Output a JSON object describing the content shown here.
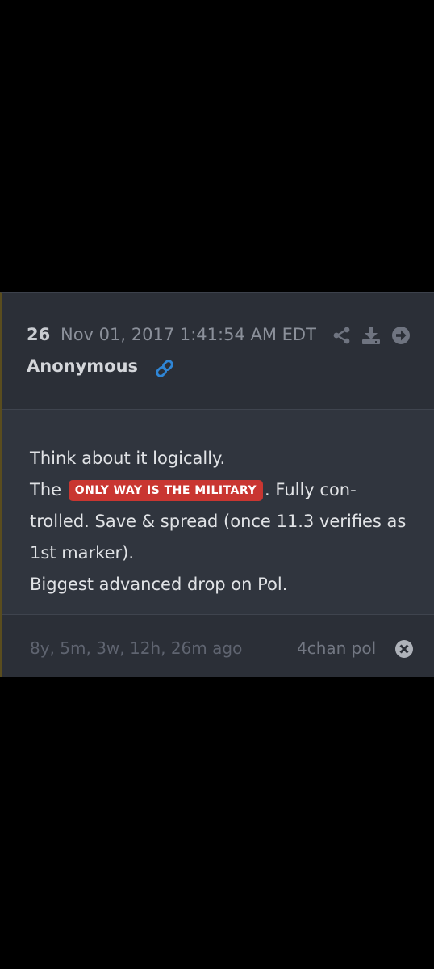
{
  "post": {
    "number": "26",
    "date": "Nov 01, 2017 1:41:54 AM EDT",
    "author": "Anonymous",
    "line1": "Think about it logically.",
    "line2_before": "The",
    "badge": "ONLY WAY IS THE MILITARY",
    "line2_after": ". Fully con-",
    "line3": "trolled. Save & spread (once 11.3 verifies as",
    "line4": "1st marker).",
    "line5": "Biggest advanced drop on Pol."
  },
  "footer": {
    "elapsed": "8y, 5m, 3w, 12h, 26m ago",
    "source": "4chan pol"
  },
  "icons": {
    "share": "share-icon",
    "download": "download-icon",
    "forward": "arrow-right-circle-icon",
    "link": "link-icon",
    "close": "close-circle-icon"
  },
  "colors": {
    "badge": "#c93631",
    "link": "#2f86d6",
    "card_background": "#2b2f37"
  }
}
